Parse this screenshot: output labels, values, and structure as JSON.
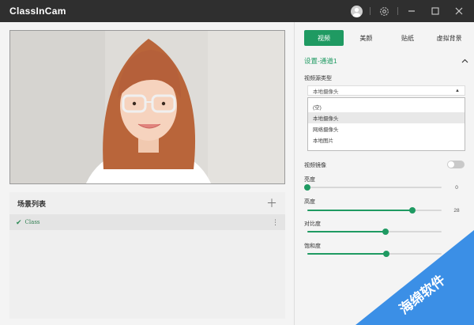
{
  "app": {
    "title": "ClassInCam"
  },
  "titlebar": {
    "icons": [
      "avatar-icon",
      "settings-icon",
      "minimize-icon",
      "maximize-icon",
      "close-icon"
    ]
  },
  "scene_panel": {
    "title": "场景列表",
    "items": [
      {
        "name": "Class",
        "checked": true
      }
    ]
  },
  "tabs": [
    {
      "label": "视频",
      "active": true
    },
    {
      "label": "美颜",
      "active": false
    },
    {
      "label": "贴纸",
      "active": false
    },
    {
      "label": "虚拟背景",
      "active": false
    }
  ],
  "settings": {
    "section_title": "设置-通道1",
    "source_type_label": "视频源类型",
    "source_type_value": "本地摄像头",
    "source_options": [
      "(空)",
      "本地摄像头",
      "网络摄像头",
      "本地图片"
    ],
    "highlighted_option": 1,
    "mirror_label": "视频镜像",
    "mirror_on": false,
    "sliders": [
      {
        "label": "亮度",
        "value": 0,
        "value_text": "0",
        "fraction": 0.0,
        "show_value": true
      },
      {
        "label": "高度",
        "value": 28,
        "value_text": "28",
        "fraction": 0.78,
        "show_value": true
      },
      {
        "label": "对比度",
        "fraction": 0.58,
        "show_value": false
      },
      {
        "label": "饱和度",
        "fraction": 0.59,
        "show_value": false
      }
    ]
  },
  "watermark": {
    "text": "海绵软件"
  },
  "colors": {
    "accent": "#1f9a62",
    "titlebar": "#2f2f2f",
    "panel": "#f4f4f4"
  }
}
